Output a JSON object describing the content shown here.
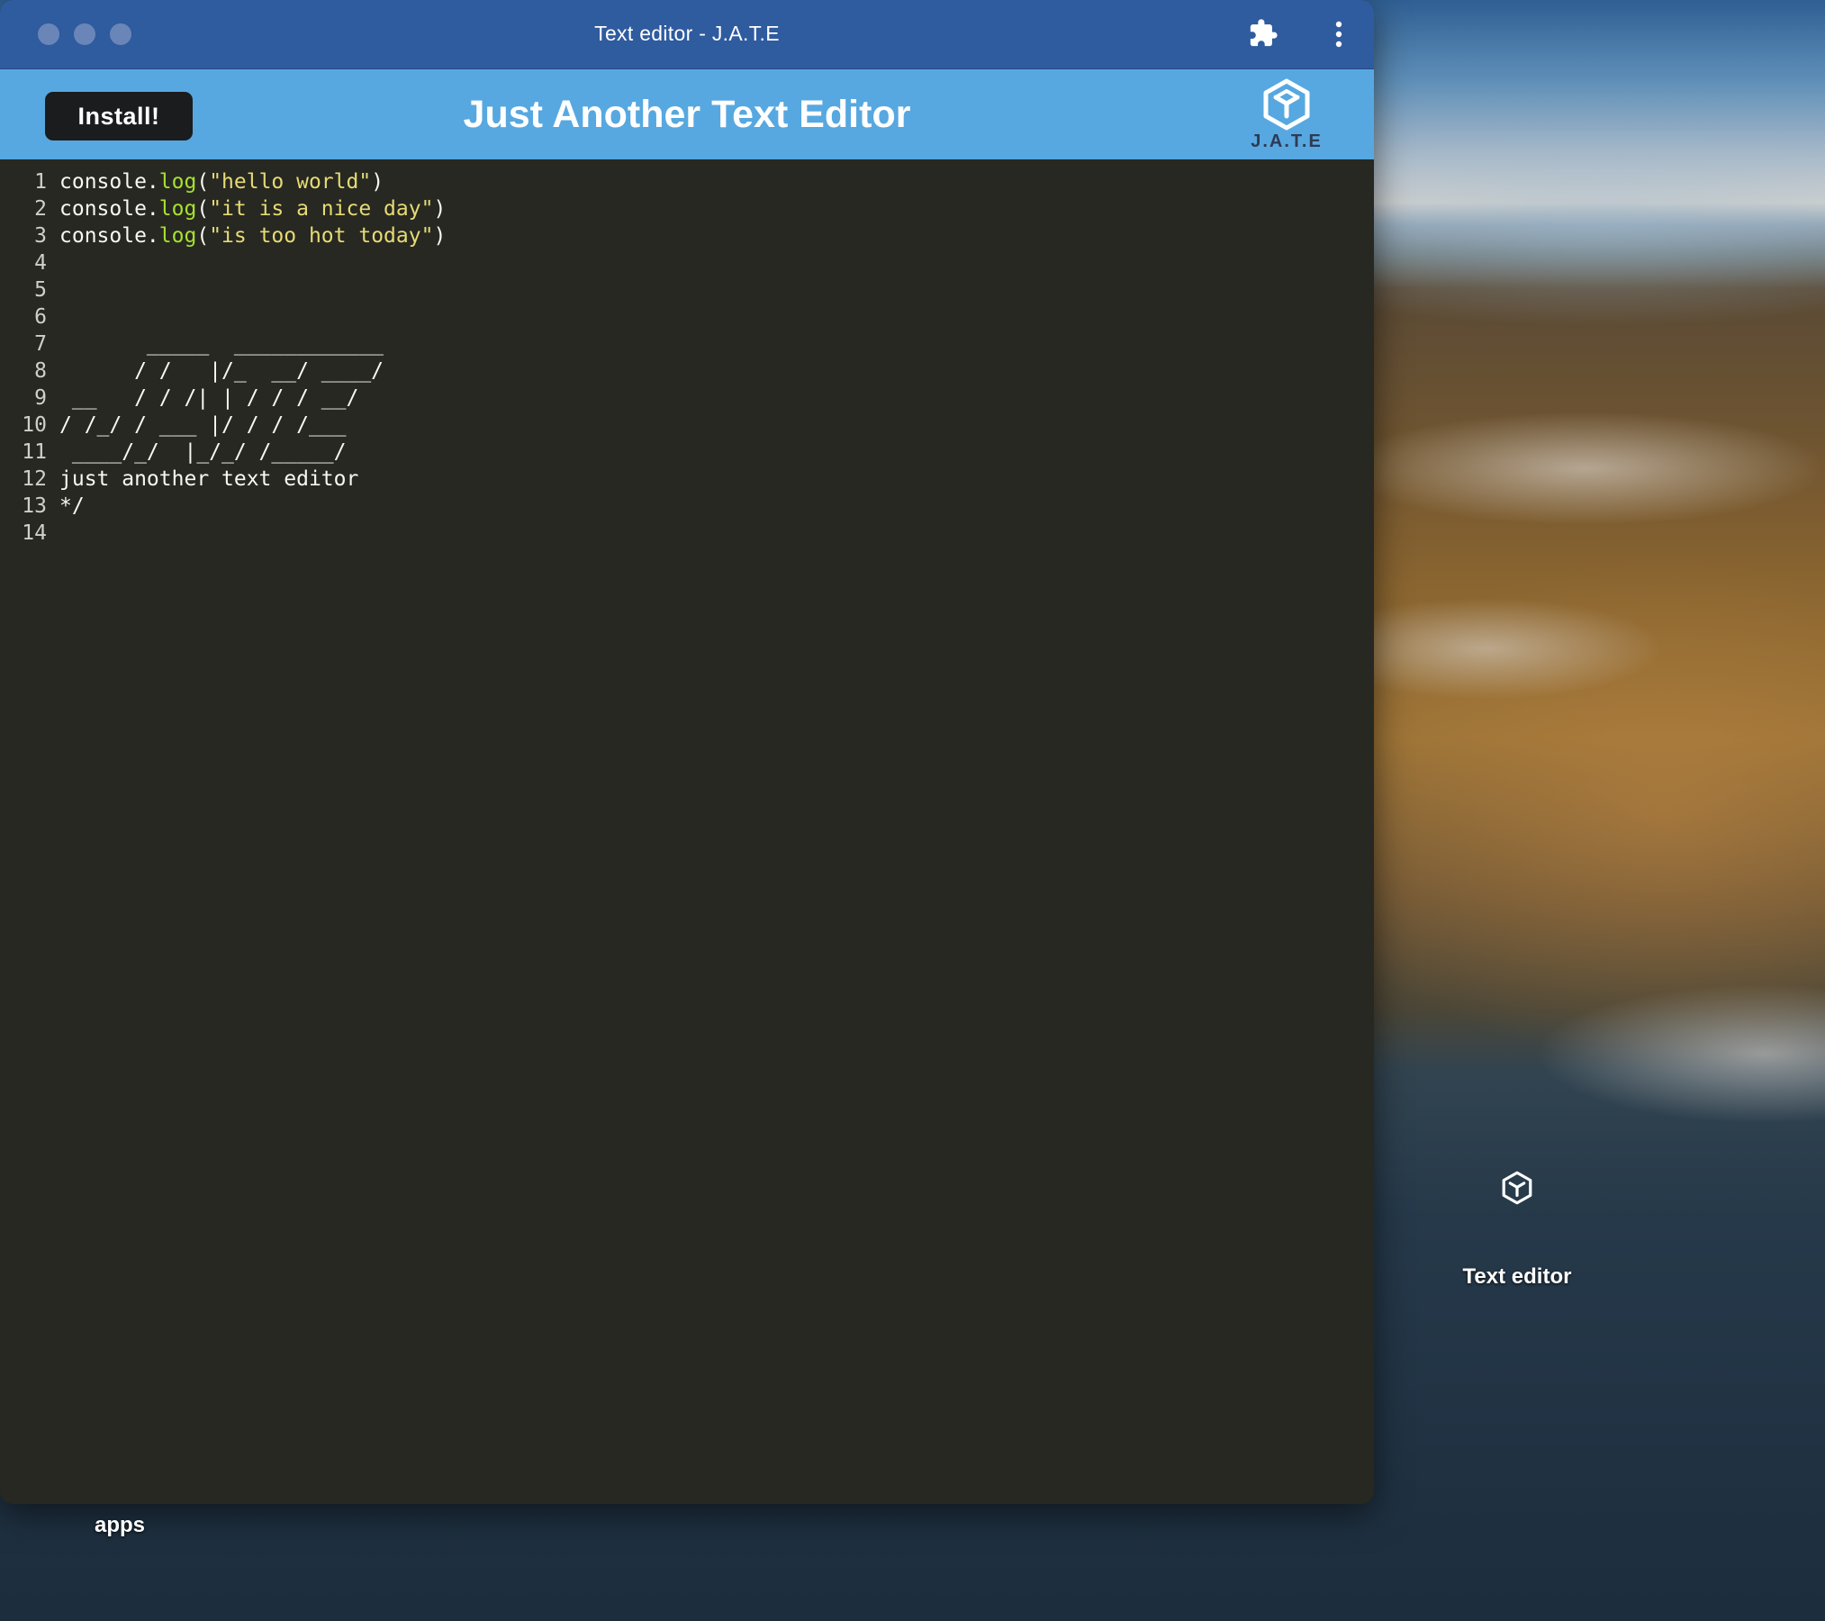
{
  "window": {
    "title": "Text editor - J.A.T.E"
  },
  "header": {
    "install_label": "Install!",
    "title": "Just Another Text Editor",
    "logo_text": "J.A.T.E"
  },
  "editor": {
    "lines": [
      {
        "num": "1",
        "tokens": [
          {
            "t": "console.",
            "c": "obj"
          },
          {
            "t": "log",
            "c": "fn"
          },
          {
            "t": "(",
            "c": "obj"
          },
          {
            "t": "\"hello world\"",
            "c": "str"
          },
          {
            "t": ")",
            "c": "obj"
          }
        ]
      },
      {
        "num": "2",
        "tokens": [
          {
            "t": "console.",
            "c": "obj"
          },
          {
            "t": "log",
            "c": "fn"
          },
          {
            "t": "(",
            "c": "obj"
          },
          {
            "t": "\"it is a nice day\"",
            "c": "str"
          },
          {
            "t": ")",
            "c": "obj"
          }
        ]
      },
      {
        "num": "3",
        "tokens": [
          {
            "t": "console.",
            "c": "obj"
          },
          {
            "t": "log",
            "c": "fn"
          },
          {
            "t": "(",
            "c": "obj"
          },
          {
            "t": "\"is too hot today\"",
            "c": "str"
          },
          {
            "t": ")",
            "c": "obj"
          }
        ]
      },
      {
        "num": "4",
        "tokens": []
      },
      {
        "num": "5",
        "tokens": []
      },
      {
        "num": "6",
        "tokens": []
      },
      {
        "num": "7",
        "tokens": [
          {
            "t": "       _____  ____________",
            "c": "text"
          }
        ]
      },
      {
        "num": "8",
        "tokens": [
          {
            "t": "      / /   |/_  __/ ____/",
            "c": "text"
          }
        ]
      },
      {
        "num": "9",
        "tokens": [
          {
            "t": " __   / / /| | / / / __/",
            "c": "text"
          }
        ]
      },
      {
        "num": "10",
        "tokens": [
          {
            "t": "/ /_/ / ___ |/ / / /___",
            "c": "text"
          }
        ]
      },
      {
        "num": "11",
        "tokens": [
          {
            "t": " ____/_/  |_/_/ /_____/",
            "c": "text"
          }
        ]
      },
      {
        "num": "12",
        "tokens": [
          {
            "t": "just another text editor",
            "c": "text"
          }
        ]
      },
      {
        "num": "13",
        "tokens": [
          {
            "t": "*/",
            "c": "text"
          }
        ]
      },
      {
        "num": "14",
        "tokens": []
      }
    ]
  },
  "desktop": {
    "icon_label": "Text editor",
    "apps_label": "apps"
  },
  "icons": {
    "extensions": "puzzle-icon",
    "menu": "kebab-menu-icon",
    "logo": "jate-cube-logo"
  },
  "colors": {
    "titlebar": "#2f5b9f",
    "header": "#57a8e0",
    "editor_bg": "#272822",
    "function": "#a6e22e",
    "string": "#e6db74"
  }
}
